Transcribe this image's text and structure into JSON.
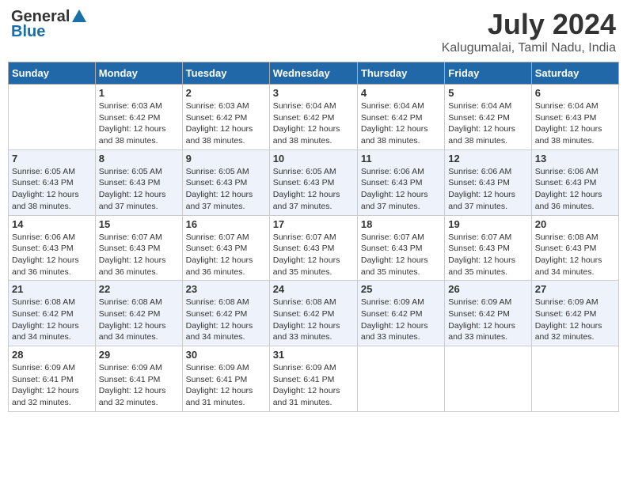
{
  "header": {
    "logo_general": "General",
    "logo_blue": "Blue",
    "month": "July 2024",
    "location": "Kalugumalai, Tamil Nadu, India"
  },
  "days_of_week": [
    "Sunday",
    "Monday",
    "Tuesday",
    "Wednesday",
    "Thursday",
    "Friday",
    "Saturday"
  ],
  "weeks": [
    [
      {
        "day": "",
        "sunrise": "",
        "sunset": "",
        "daylight": ""
      },
      {
        "day": "1",
        "sunrise": "Sunrise: 6:03 AM",
        "sunset": "Sunset: 6:42 PM",
        "daylight": "Daylight: 12 hours and 38 minutes."
      },
      {
        "day": "2",
        "sunrise": "Sunrise: 6:03 AM",
        "sunset": "Sunset: 6:42 PM",
        "daylight": "Daylight: 12 hours and 38 minutes."
      },
      {
        "day": "3",
        "sunrise": "Sunrise: 6:04 AM",
        "sunset": "Sunset: 6:42 PM",
        "daylight": "Daylight: 12 hours and 38 minutes."
      },
      {
        "day": "4",
        "sunrise": "Sunrise: 6:04 AM",
        "sunset": "Sunset: 6:42 PM",
        "daylight": "Daylight: 12 hours and 38 minutes."
      },
      {
        "day": "5",
        "sunrise": "Sunrise: 6:04 AM",
        "sunset": "Sunset: 6:42 PM",
        "daylight": "Daylight: 12 hours and 38 minutes."
      },
      {
        "day": "6",
        "sunrise": "Sunrise: 6:04 AM",
        "sunset": "Sunset: 6:43 PM",
        "daylight": "Daylight: 12 hours and 38 minutes."
      }
    ],
    [
      {
        "day": "7",
        "sunrise": "Sunrise: 6:05 AM",
        "sunset": "Sunset: 6:43 PM",
        "daylight": "Daylight: 12 hours and 38 minutes."
      },
      {
        "day": "8",
        "sunrise": "Sunrise: 6:05 AM",
        "sunset": "Sunset: 6:43 PM",
        "daylight": "Daylight: 12 hours and 37 minutes."
      },
      {
        "day": "9",
        "sunrise": "Sunrise: 6:05 AM",
        "sunset": "Sunset: 6:43 PM",
        "daylight": "Daylight: 12 hours and 37 minutes."
      },
      {
        "day": "10",
        "sunrise": "Sunrise: 6:05 AM",
        "sunset": "Sunset: 6:43 PM",
        "daylight": "Daylight: 12 hours and 37 minutes."
      },
      {
        "day": "11",
        "sunrise": "Sunrise: 6:06 AM",
        "sunset": "Sunset: 6:43 PM",
        "daylight": "Daylight: 12 hours and 37 minutes."
      },
      {
        "day": "12",
        "sunrise": "Sunrise: 6:06 AM",
        "sunset": "Sunset: 6:43 PM",
        "daylight": "Daylight: 12 hours and 37 minutes."
      },
      {
        "day": "13",
        "sunrise": "Sunrise: 6:06 AM",
        "sunset": "Sunset: 6:43 PM",
        "daylight": "Daylight: 12 hours and 36 minutes."
      }
    ],
    [
      {
        "day": "14",
        "sunrise": "Sunrise: 6:06 AM",
        "sunset": "Sunset: 6:43 PM",
        "daylight": "Daylight: 12 hours and 36 minutes."
      },
      {
        "day": "15",
        "sunrise": "Sunrise: 6:07 AM",
        "sunset": "Sunset: 6:43 PM",
        "daylight": "Daylight: 12 hours and 36 minutes."
      },
      {
        "day": "16",
        "sunrise": "Sunrise: 6:07 AM",
        "sunset": "Sunset: 6:43 PM",
        "daylight": "Daylight: 12 hours and 36 minutes."
      },
      {
        "day": "17",
        "sunrise": "Sunrise: 6:07 AM",
        "sunset": "Sunset: 6:43 PM",
        "daylight": "Daylight: 12 hours and 35 minutes."
      },
      {
        "day": "18",
        "sunrise": "Sunrise: 6:07 AM",
        "sunset": "Sunset: 6:43 PM",
        "daylight": "Daylight: 12 hours and 35 minutes."
      },
      {
        "day": "19",
        "sunrise": "Sunrise: 6:07 AM",
        "sunset": "Sunset: 6:43 PM",
        "daylight": "Daylight: 12 hours and 35 minutes."
      },
      {
        "day": "20",
        "sunrise": "Sunrise: 6:08 AM",
        "sunset": "Sunset: 6:43 PM",
        "daylight": "Daylight: 12 hours and 34 minutes."
      }
    ],
    [
      {
        "day": "21",
        "sunrise": "Sunrise: 6:08 AM",
        "sunset": "Sunset: 6:42 PM",
        "daylight": "Daylight: 12 hours and 34 minutes."
      },
      {
        "day": "22",
        "sunrise": "Sunrise: 6:08 AM",
        "sunset": "Sunset: 6:42 PM",
        "daylight": "Daylight: 12 hours and 34 minutes."
      },
      {
        "day": "23",
        "sunrise": "Sunrise: 6:08 AM",
        "sunset": "Sunset: 6:42 PM",
        "daylight": "Daylight: 12 hours and 34 minutes."
      },
      {
        "day": "24",
        "sunrise": "Sunrise: 6:08 AM",
        "sunset": "Sunset: 6:42 PM",
        "daylight": "Daylight: 12 hours and 33 minutes."
      },
      {
        "day": "25",
        "sunrise": "Sunrise: 6:09 AM",
        "sunset": "Sunset: 6:42 PM",
        "daylight": "Daylight: 12 hours and 33 minutes."
      },
      {
        "day": "26",
        "sunrise": "Sunrise: 6:09 AM",
        "sunset": "Sunset: 6:42 PM",
        "daylight": "Daylight: 12 hours and 33 minutes."
      },
      {
        "day": "27",
        "sunrise": "Sunrise: 6:09 AM",
        "sunset": "Sunset: 6:42 PM",
        "daylight": "Daylight: 12 hours and 32 minutes."
      }
    ],
    [
      {
        "day": "28",
        "sunrise": "Sunrise: 6:09 AM",
        "sunset": "Sunset: 6:41 PM",
        "daylight": "Daylight: 12 hours and 32 minutes."
      },
      {
        "day": "29",
        "sunrise": "Sunrise: 6:09 AM",
        "sunset": "Sunset: 6:41 PM",
        "daylight": "Daylight: 12 hours and 32 minutes."
      },
      {
        "day": "30",
        "sunrise": "Sunrise: 6:09 AM",
        "sunset": "Sunset: 6:41 PM",
        "daylight": "Daylight: 12 hours and 31 minutes."
      },
      {
        "day": "31",
        "sunrise": "Sunrise: 6:09 AM",
        "sunset": "Sunset: 6:41 PM",
        "daylight": "Daylight: 12 hours and 31 minutes."
      },
      {
        "day": "",
        "sunrise": "",
        "sunset": "",
        "daylight": ""
      },
      {
        "day": "",
        "sunrise": "",
        "sunset": "",
        "daylight": ""
      },
      {
        "day": "",
        "sunrise": "",
        "sunset": "",
        "daylight": ""
      }
    ]
  ]
}
